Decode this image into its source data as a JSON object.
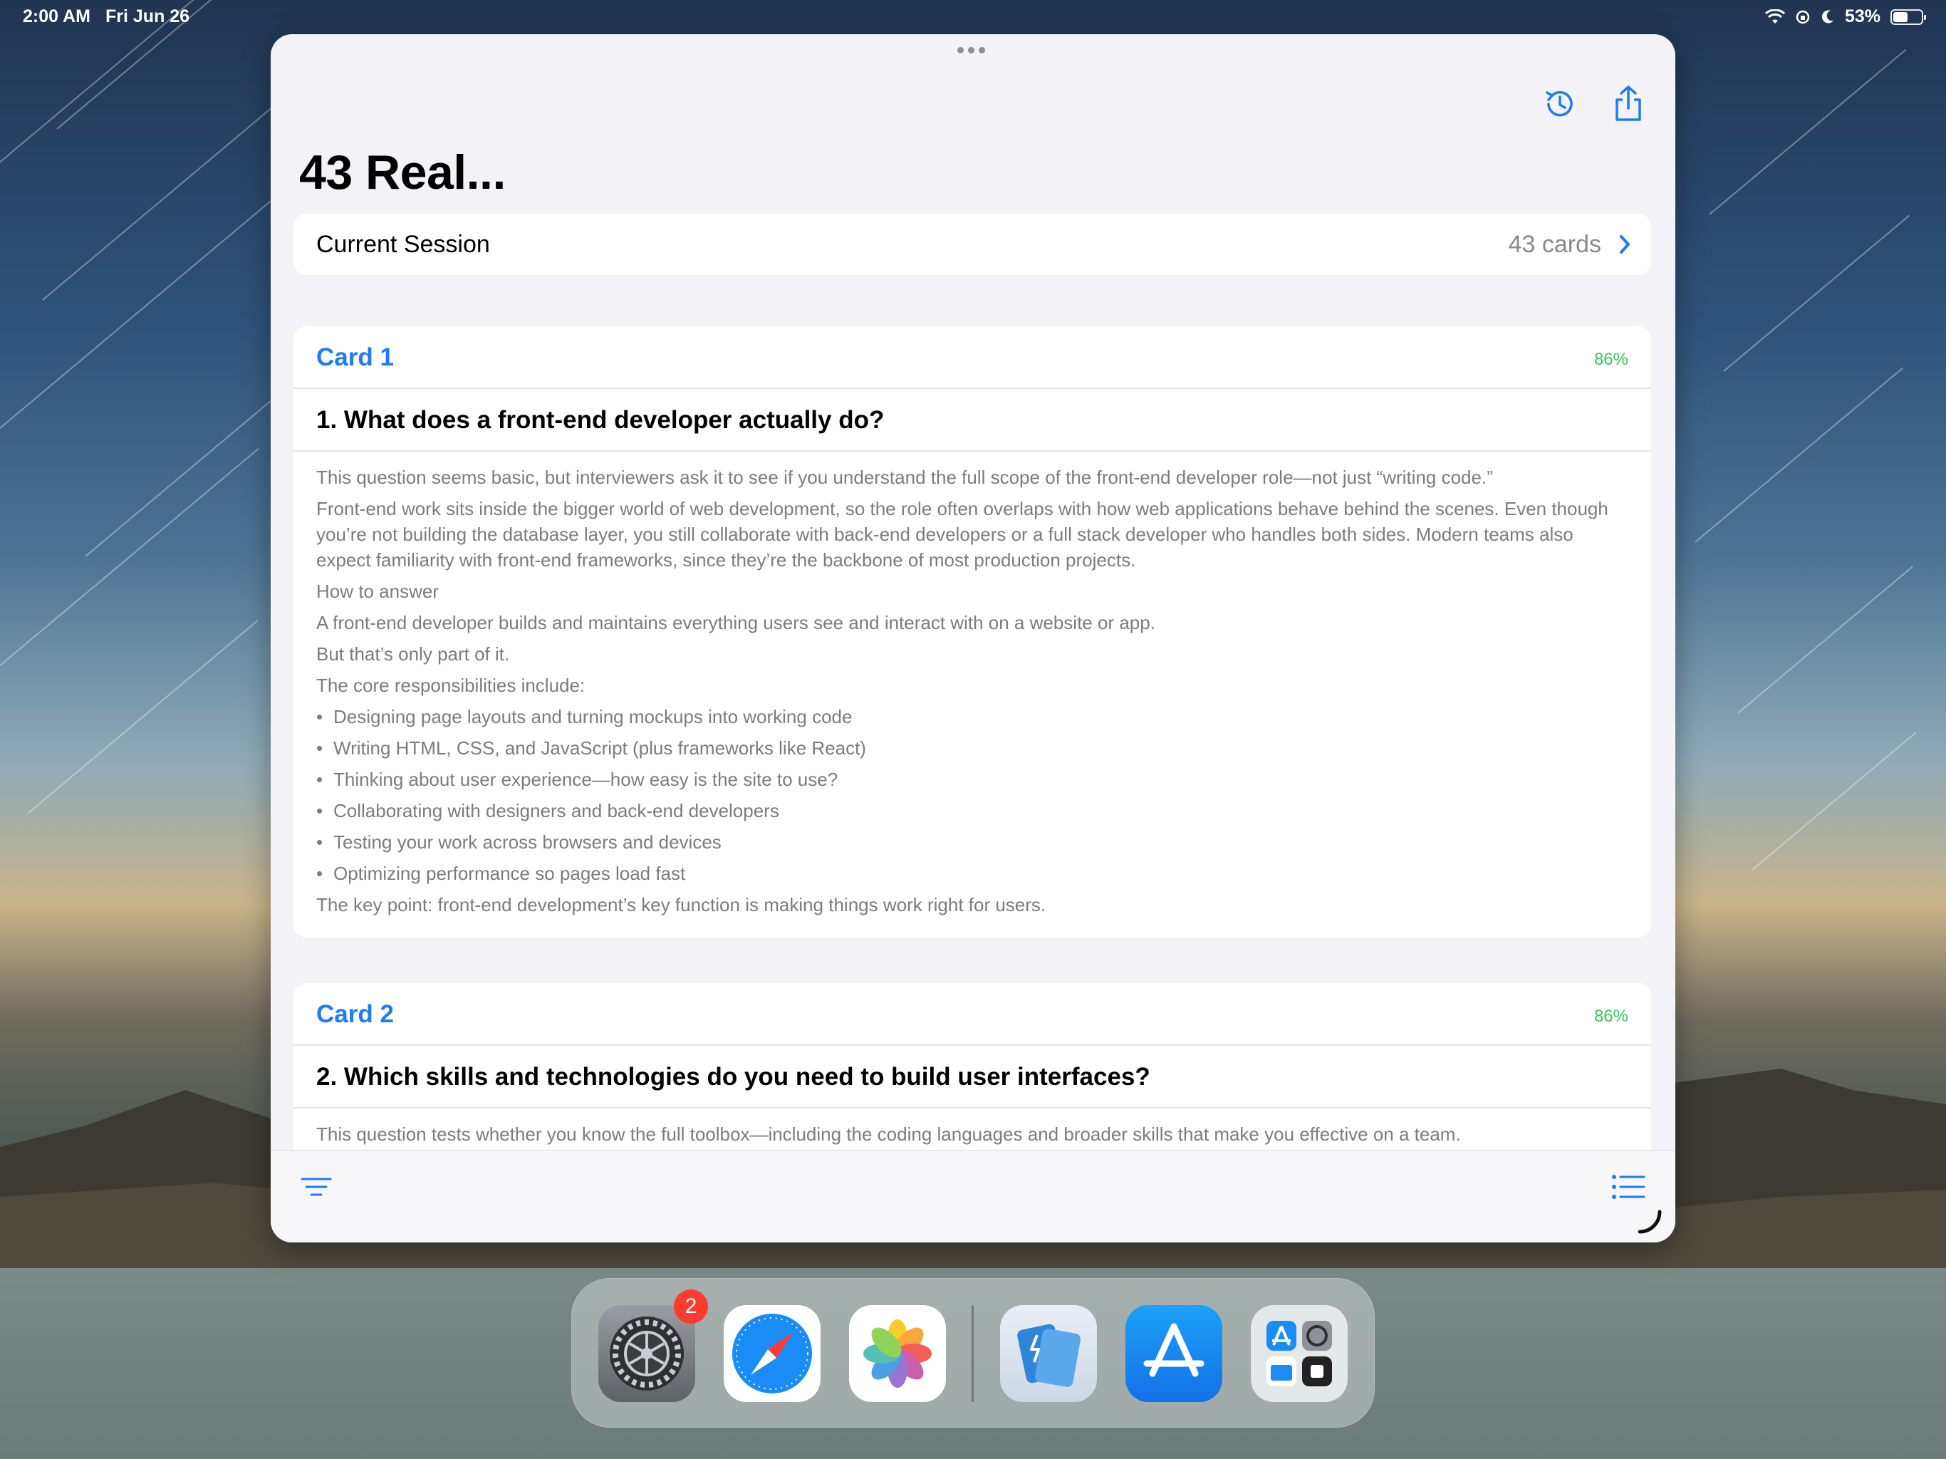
{
  "status_bar": {
    "time": "2:00 AM",
    "date": "Fri Jun 26",
    "battery": "53%",
    "battery_level": 0.53
  },
  "window": {
    "title": "43 Real...",
    "toolbar": {
      "history_icon": "history-icon",
      "share_icon": "share-icon"
    },
    "session": {
      "label": "Current Session",
      "count": "43 cards"
    },
    "cards": [
      {
        "name": "Card 1",
        "percent": "86%",
        "question": "1. What does a front-end developer actually do?",
        "p1": "This question seems basic, but interviewers ask it to see if you understand the full scope of the front-end developer role—not just “writing code.”",
        "p2": "Front-end work sits inside the bigger world of web development, so the role often overlaps with how web applications behave behind the scenes. Even though you’re not building the database layer, you still collaborate with back-end developers or a full stack developer who handles both sides. Modern teams also expect familiarity with front-end frameworks, since they’re the backbone of most production projects.",
        "p3": "How to answer",
        "p4": "A front-end developer builds and maintains everything users see and interact with on a website or app.",
        "p5": "But that’s only part of it.",
        "p6": "The core responsibilities include:",
        "bullets": [
          "Designing page layouts and turning mockups into working code",
          "Writing HTML, CSS, and JavaScript (plus frameworks like React)",
          "Thinking about user experience—how easy is the site to use?",
          "Collaborating with designers and back-end developers",
          "Testing your work across browsers and devices",
          "Optimizing performance so pages load fast"
        ],
        "p7": "The key point: front-end development’s key function is making things work right for users."
      },
      {
        "name": "Card 2",
        "percent": "86%",
        "question": "2. Which skills and technologies do you need to build user interfaces?",
        "p1": "This question tests whether you know the full toolbox—including the coding languages and broader skills that make you effective on a team."
      }
    ],
    "bottom_bar": {
      "left_icon": "filter-icon",
      "right_icon": "list-icon"
    }
  },
  "dock": {
    "apps": [
      "Settings",
      "Safari",
      "Photos",
      "Flashcards",
      "App Store",
      "App Library"
    ],
    "settings_badge": "2"
  },
  "colors": {
    "accent": "#1e7cf2",
    "percent": "#34c759",
    "badge": "#ff3b30"
  }
}
